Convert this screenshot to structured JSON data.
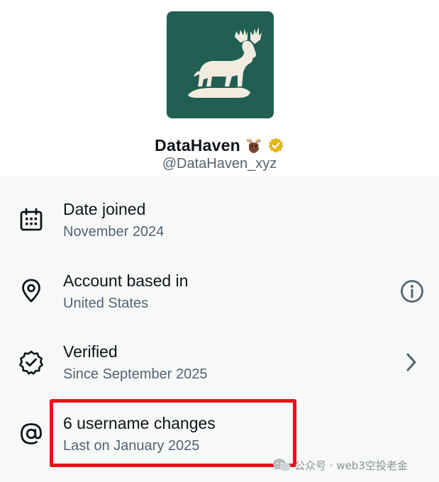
{
  "profile": {
    "name": "DataHaven",
    "name_emoji": "🫎",
    "handle": "@DataHaven_xyz",
    "avatar_bg": "#215f53",
    "avatar_fg": "#f1ecdf"
  },
  "about": {
    "rows": [
      {
        "icon": "calendar-icon",
        "title": "Date joined",
        "subtitle": "November 2024"
      },
      {
        "icon": "location-pin-icon",
        "title": "Account based in",
        "subtitle": "United States",
        "trailing": "info-icon"
      },
      {
        "icon": "verified-badge-icon",
        "title": "Verified",
        "subtitle": "Since September 2025",
        "trailing": "chevron-right-icon"
      },
      {
        "icon": "at-sign-icon",
        "title": "6 username changes",
        "subtitle": "Last on January 2025"
      }
    ]
  },
  "annotation": {
    "highlight_color": "#e8121a"
  },
  "watermark": {
    "text": "公众号 · web3空投老金"
  },
  "colors": {
    "text_primary": "#0f1419",
    "text_secondary": "#536471",
    "verified_gold": "#e2b719",
    "list_bg": "#f7f9f9"
  }
}
